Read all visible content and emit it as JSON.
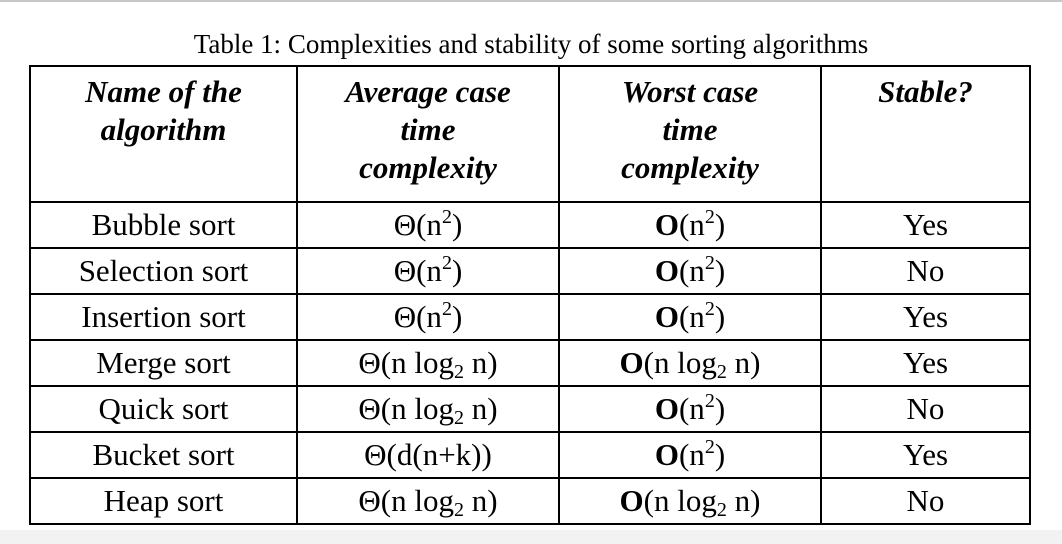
{
  "caption": "Table 1: Complexities and stability of some sorting algorithms",
  "headers": {
    "name": [
      "Name of the",
      "algorithm"
    ],
    "average": [
      "Average case",
      "time",
      "complexity"
    ],
    "worst": [
      "Worst case",
      "time",
      "complexity"
    ],
    "stable": [
      "Stable?"
    ]
  },
  "rows": [
    {
      "name": "Bubble sort",
      "average": {
        "pre": "Θ(n",
        "sup": "2",
        "sub": "",
        "post": ")"
      },
      "worst": {
        "letter": "O",
        "pre": "(n",
        "sup": "2",
        "sub": "",
        "post": ")"
      },
      "stable": "Yes"
    },
    {
      "name": "Selection sort",
      "average": {
        "pre": "Θ(n",
        "sup": "2",
        "sub": "",
        "post": ")"
      },
      "worst": {
        "letter": "O",
        "pre": "(n",
        "sup": "2",
        "sub": "",
        "post": ")"
      },
      "stable": "No"
    },
    {
      "name": "Insertion sort",
      "average": {
        "pre": "Θ(n",
        "sup": "2",
        "sub": "",
        "post": ")"
      },
      "worst": {
        "letter": "O",
        "pre": "(n",
        "sup": "2",
        "sub": "",
        "post": ")"
      },
      "stable": "Yes"
    },
    {
      "name": "Merge sort",
      "average": {
        "pre": "Θ(n log",
        "sup": "",
        "sub": "2",
        "post": " n)"
      },
      "worst": {
        "letter": "O",
        "pre": "(n log",
        "sup": "",
        "sub": "2",
        "post": " n)"
      },
      "stable": "Yes"
    },
    {
      "name": "Quick sort",
      "average": {
        "pre": "Θ(n log",
        "sup": "",
        "sub": "2",
        "post": " n)"
      },
      "worst": {
        "letter": "O",
        "pre": "(n",
        "sup": "2",
        "sub": "",
        "post": ")"
      },
      "stable": "No"
    },
    {
      "name": "Bucket sort",
      "average": {
        "pre": "Θ(d(n+k))",
        "sup": "",
        "sub": "",
        "post": ""
      },
      "worst": {
        "letter": "O",
        "pre": "(n",
        "sup": "2",
        "sub": "",
        "post": ")"
      },
      "stable": "Yes"
    },
    {
      "name": "Heap sort",
      "average": {
        "pre": "Θ(n log",
        "sup": "",
        "sub": "2",
        "post": " n)"
      },
      "worst": {
        "letter": "O",
        "pre": "(n log",
        "sup": "",
        "sub": "2",
        "post": " n)"
      },
      "stable": "No"
    }
  ]
}
